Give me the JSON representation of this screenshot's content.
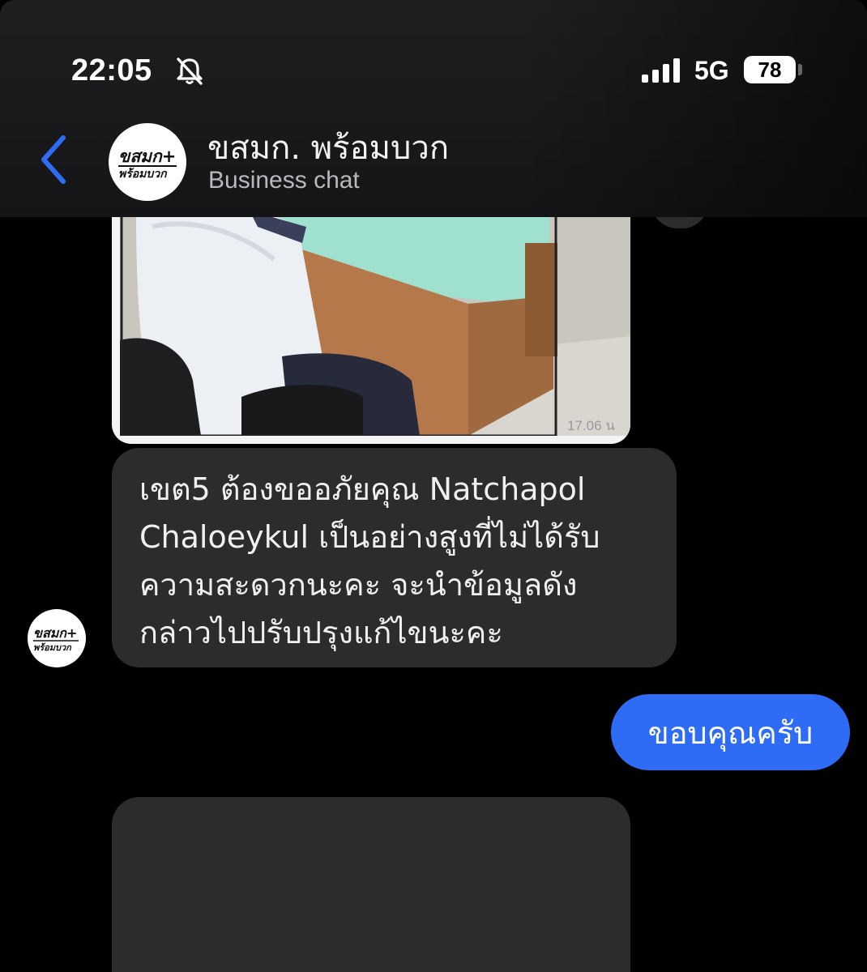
{
  "status_bar": {
    "time": "22:05",
    "network": "5G",
    "battery": "78",
    "icons": [
      "bell-slash-icon",
      "signal-bars-icon",
      "battery-icon"
    ]
  },
  "header": {
    "back_icon": "chevron-left-icon",
    "title": "ขสมก. พร้อมบวก",
    "subtitle": "Business chat",
    "avatar_logo_line1": "ขสมก+",
    "avatar_logo_line2": "พร้อมบวก"
  },
  "messages": [
    {
      "type": "image",
      "direction": "incoming",
      "time": "17.06 น"
    },
    {
      "type": "text",
      "direction": "incoming",
      "lines": [
        "เขต5 ต้องขออภัยคุณ Natchapol",
        "Chaloeykul เป็นอย่างสูงที่ไม่ได้รับ",
        "ความสะดวกนะคะ จะนำข้อมูลดัง",
        "กล่าวไปปรับปรุงแก้ไขนะคะ"
      ]
    },
    {
      "type": "text",
      "direction": "outgoing",
      "text": "ขอบคุณครับ"
    },
    {
      "type": "placeholder",
      "direction": "incoming"
    }
  ],
  "colors": {
    "background": "#000000",
    "incoming_bubble": "#2c2c2e",
    "outgoing_bubble": "#2f6cf6",
    "back_chevron": "#2f6cf6"
  }
}
